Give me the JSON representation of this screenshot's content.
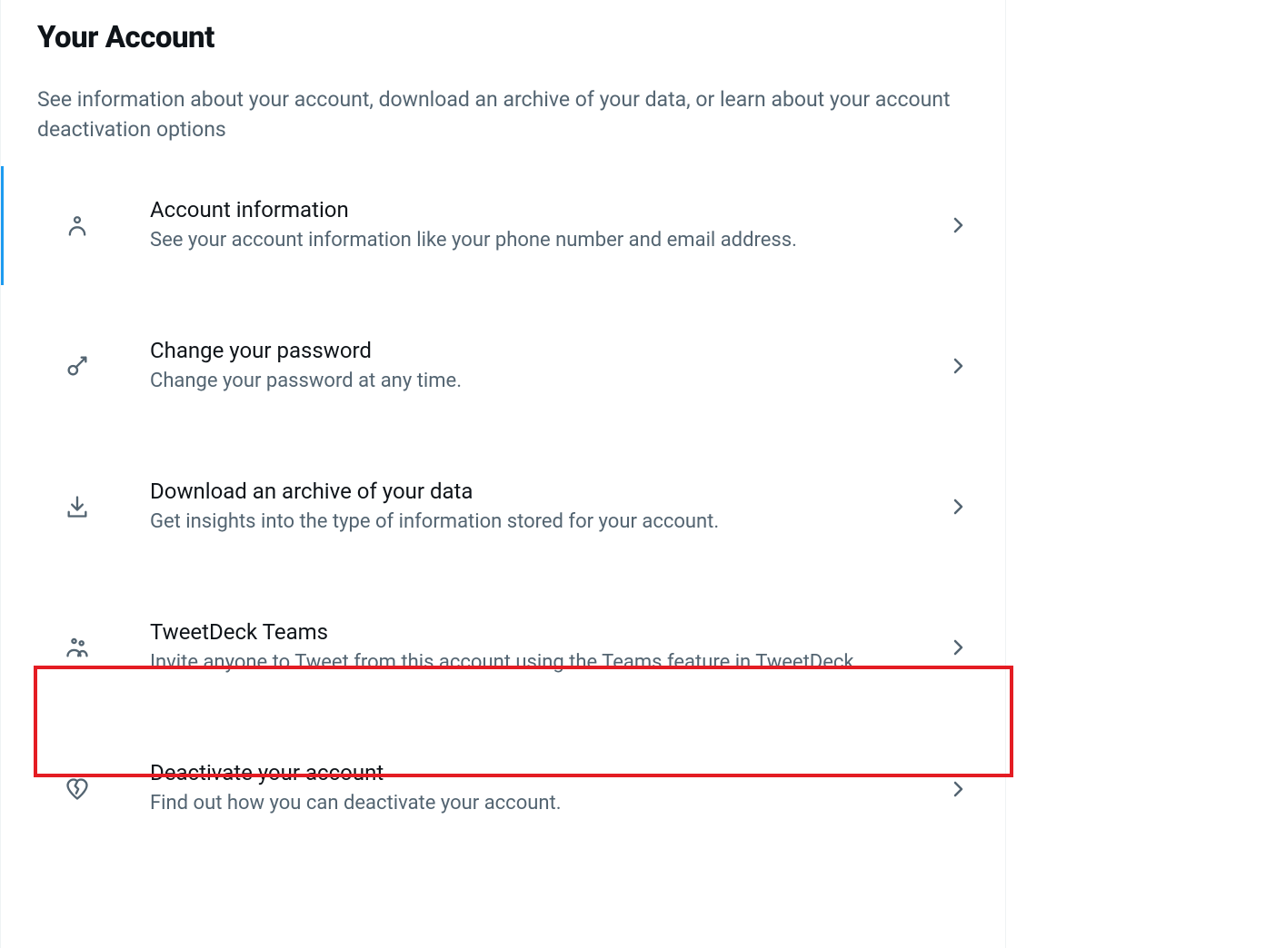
{
  "header": {
    "title": "Your Account",
    "description": "See information about your account, download an archive of your data, or learn about your account deactivation options"
  },
  "items": [
    {
      "icon": "person-icon",
      "title": "Account information",
      "desc": "See your account information like your phone number and email address."
    },
    {
      "icon": "key-icon",
      "title": "Change your password",
      "desc": "Change your password at any time."
    },
    {
      "icon": "download-icon",
      "title": "Download an archive of your data",
      "desc": "Get insights into the type of information stored for your account."
    },
    {
      "icon": "teams-icon",
      "title": "TweetDeck Teams",
      "desc": "Invite anyone to Tweet from this account using the Teams feature in TweetDeck."
    },
    {
      "icon": "heart-broken-icon",
      "title": "Deactivate your account",
      "desc": "Find out how you can deactivate your account."
    }
  ]
}
